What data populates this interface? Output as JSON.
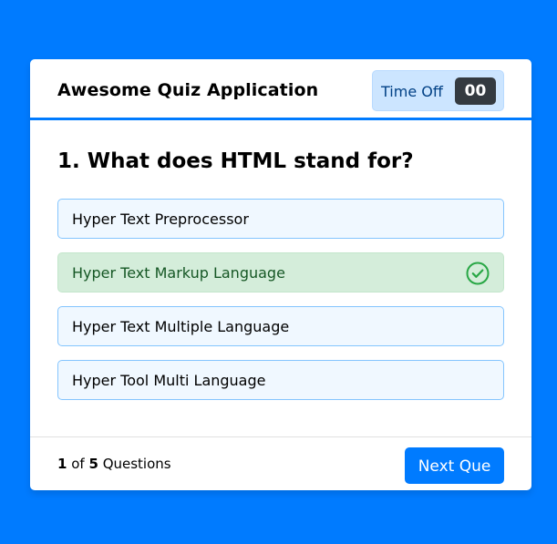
{
  "header": {
    "title": "Awesome Quiz Application",
    "timer_label": "Time Off",
    "timer_value": "00"
  },
  "question": {
    "text": "1. What does HTML stand for?",
    "options": [
      {
        "label": "Hyper Text Preprocessor",
        "state": "default"
      },
      {
        "label": "Hyper Text Markup Language",
        "state": "correct",
        "icon": "check-circle-icon"
      },
      {
        "label": "Hyper Text Multiple Language",
        "state": "default"
      },
      {
        "label": "Hyper Tool Multi Language",
        "state": "default"
      }
    ]
  },
  "footer": {
    "current": "1",
    "of_text": "of",
    "total": "5",
    "questions_text": "Questions",
    "next_label": "Next Que"
  },
  "colors": {
    "background": "#007bff",
    "header_border": "#007bff",
    "option_bg": "#f0f8ff",
    "option_border": "#84c5fe",
    "correct_bg": "#d4edda",
    "correct_text": "#155724",
    "correct_icon": "#28a745",
    "timer_bg": "#cce5ff",
    "timer_sec_bg": "#343a40",
    "button_bg": "#007bff"
  }
}
